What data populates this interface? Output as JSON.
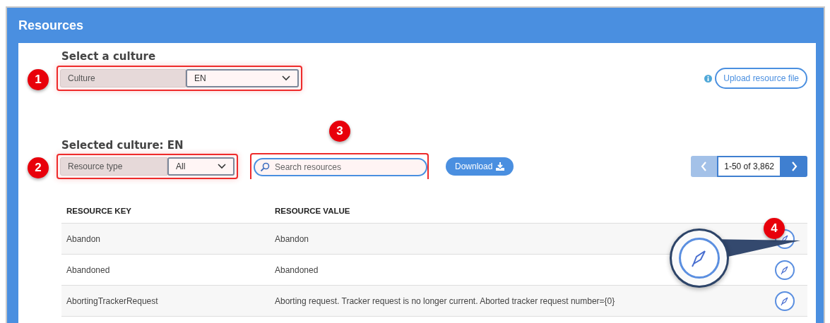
{
  "panel": {
    "title": "Resources"
  },
  "culture_section": {
    "heading": "Select a culture",
    "field_label": "Culture",
    "value": "EN",
    "annotation": "1"
  },
  "upload_button": "Upload resource file",
  "selected_section": {
    "heading": "Selected culture: EN",
    "field_label": "Resource type",
    "value": "All",
    "annotation": "2"
  },
  "search": {
    "placeholder": "Search resources",
    "annotation": "3"
  },
  "download_button": "Download",
  "pagination": {
    "range": "1-50 of 3,862"
  },
  "table": {
    "columns": [
      "RESOURCE KEY",
      "RESOURCE VALUE"
    ],
    "rows": [
      {
        "key": "Abandon",
        "value": "Abandon"
      },
      {
        "key": "Abandoned",
        "value": "Abandoned"
      },
      {
        "key": "AbortingTrackerRequest",
        "value": "Aborting request. Tracker request is no longer current. Aborted tracker request number={0}"
      }
    ],
    "edit_annotation": "4"
  }
}
